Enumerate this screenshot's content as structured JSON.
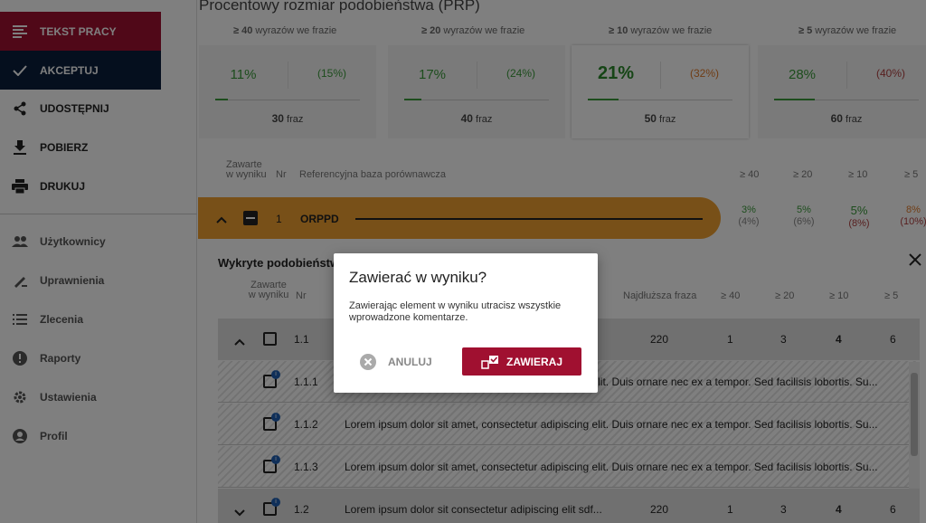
{
  "sidebar": {
    "primary": [
      {
        "label": "TEKST PRACY",
        "icon": "menu-lines-icon",
        "color": "#a01030"
      },
      {
        "label": "AKCEPTUJ",
        "icon": "check-icon",
        "color": "#0a1e3c"
      }
    ],
    "actions": [
      {
        "label": "UDOSTĘPNIJ",
        "icon": "share-icon"
      },
      {
        "label": "POBIERZ",
        "icon": "download-icon"
      },
      {
        "label": "DRUKUJ",
        "icon": "print-icon"
      }
    ],
    "nav": [
      {
        "label": "Użytkownicy",
        "icon": "users-icon"
      },
      {
        "label": "Uprawnienia",
        "icon": "permissions-icon"
      },
      {
        "label": "Zlecenia",
        "icon": "list-icon"
      },
      {
        "label": "Raporty",
        "icon": "alert-icon"
      },
      {
        "label": "Ustawienia",
        "icon": "gear-icon"
      },
      {
        "label": "Profil",
        "icon": "profile-icon"
      }
    ]
  },
  "prp": {
    "title": "Procentowy rozmiar podobieństwa (PRP)",
    "cards": [
      {
        "head_bold": "≥ 40",
        "head_rest": " wyrazów we frazie",
        "pct": "11%",
        "pct2": "(15%)",
        "count": "30",
        "unit": "fraz",
        "bar_fraction": 0.09
      },
      {
        "head_bold": "≥ 20",
        "head_rest": " wyrazów we frazie",
        "pct": "17%",
        "pct2": "(24%)",
        "count": "40",
        "unit": "fraz",
        "bar_fraction": 0.12
      },
      {
        "head_bold": "≥ 10",
        "head_rest": " wyrazów we frazie",
        "pct": "21%",
        "pct2": "(32%)",
        "count": "50",
        "unit": "fraz",
        "bar_fraction": 0.21
      },
      {
        "head_bold": "≥ 5",
        "head_rest": " wyrazów we frazie",
        "pct": "28%",
        "pct2": "(40%)",
        "count": "60",
        "unit": "fraz",
        "bar_fraction": 0.28
      }
    ]
  },
  "table": {
    "col_zawarte": "Zawarte w wyniku",
    "col_nr": "Nr",
    "col_baza": "Referencyjna baza porównawcza",
    "col_ge40": "≥ 40",
    "col_ge20": "≥ 20",
    "col_ge10": "≥ 10",
    "col_ge5": "≥ 5",
    "source_row": {
      "nr": "1",
      "name": "ORPPD",
      "ge40": "3%",
      "ge40b": "(4%)",
      "ge20": "5%",
      "ge20b": "(6%)",
      "ge10": "5%",
      "ge10b": "(8%)",
      "ge5": "8%",
      "ge5b": "(10%)"
    }
  },
  "detail": {
    "title": "Wykryte podobieństwa",
    "col_zawarte": "Zawarte w wyniku",
    "col_nr": "Nr",
    "col_najdluzsza": "Najdłuższa fraza",
    "col_ge40": "≥ 40",
    "col_ge20": "≥ 20",
    "col_ge10": "≥ 10",
    "col_ge5": "≥ 5",
    "row_1_1": {
      "nr": "1.1",
      "len": "220",
      "ge40": "1",
      "ge20": "3",
      "ge10": "4",
      "ge5": "6"
    },
    "subrows": [
      {
        "nr": "1.1.1",
        "text": "Lorem ipsum dolor sit amet, consectetur adipiscing elit. Duis ornare nec ex a tempor. Sed facilisis lobortis. Su..."
      },
      {
        "nr": "1.1.2",
        "text": "Lorem ipsum dolor sit amet, consectetur adipiscing elit. Duis ornare nec ex a tempor. Sed facilisis lobortis. Su..."
      },
      {
        "nr": "1.1.3",
        "text": "Lorem ipsum dolor sit amet, consectetur adipiscing elit. Duis ornare nec ex a tempor. Sed facilisis lobortis. Su..."
      }
    ],
    "row_1_2": {
      "nr": "1.2",
      "text": "Lorem ipsum dolor sit consectetur adipiscing elit sdf...",
      "len": "220",
      "ge40": "1",
      "ge20": "3",
      "ge10": "4",
      "ge5": "6"
    },
    "row_1_1_fragment": "...",
    "title_fragment": "Wykryte podobieństwa"
  },
  "dialog": {
    "title": "Zawierać w wyniku?",
    "message": "Zawierając element w wyniku utracisz wszystkie wprowadzone komentarze.",
    "cancel_label": "ANULUJ",
    "confirm_label": "ZAWIERAJ",
    "confirm_color": "#a01030"
  }
}
